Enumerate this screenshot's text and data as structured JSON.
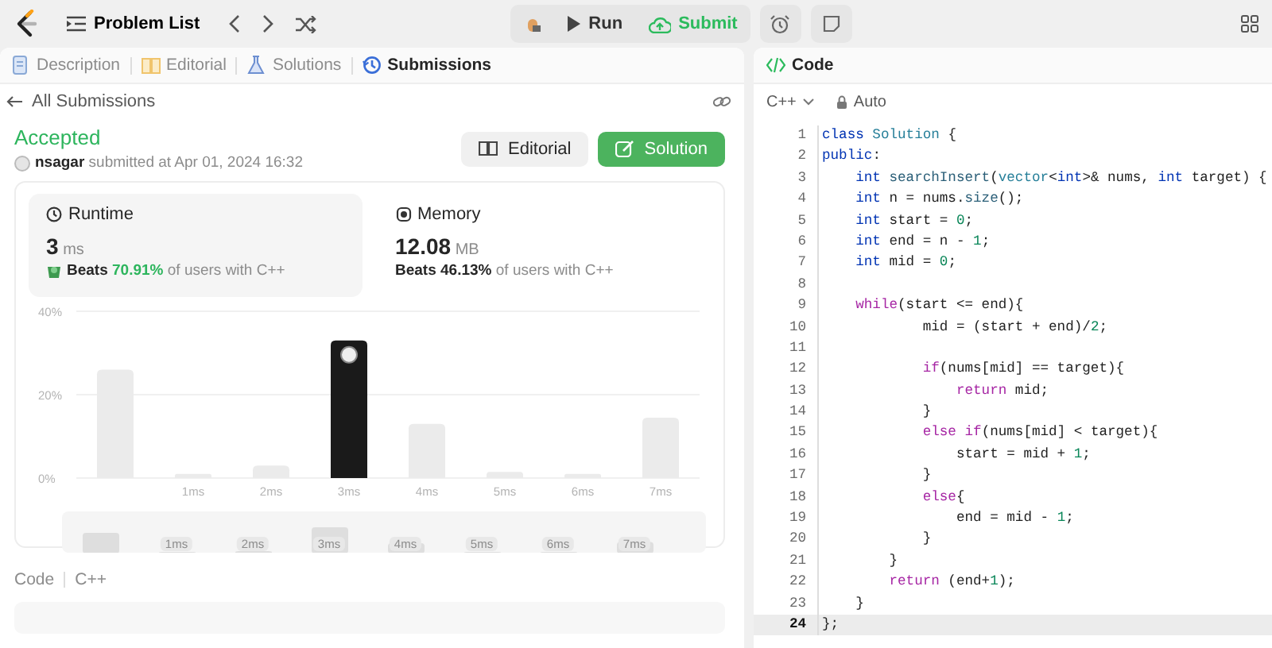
{
  "topbar": {
    "problem_list": "Problem List",
    "run": "Run",
    "submit": "Submit"
  },
  "left_tabs": [
    {
      "label": "Description",
      "kind": "description",
      "selected": false
    },
    {
      "label": "Editorial",
      "kind": "editorial",
      "selected": false
    },
    {
      "label": "Solutions",
      "kind": "solutions",
      "selected": false
    },
    {
      "label": "Submissions",
      "kind": "submissions",
      "selected": true
    }
  ],
  "back_link": "All Submissions",
  "submission": {
    "status": "Accepted",
    "user": "nsagar",
    "submitted": "submitted at Apr 01, 2024 16:32",
    "buttons": [
      {
        "label": "Editorial",
        "kind": "secondary"
      },
      {
        "label": "Solution",
        "kind": "primary"
      }
    ]
  },
  "stats": [
    {
      "kind": "runtime",
      "title": "Runtime",
      "value": "3",
      "unit": "ms",
      "beats_label": "Beats",
      "beats": "70.91%",
      "rest": "of users with C++",
      "selected": true
    },
    {
      "kind": "memory",
      "title": "Memory",
      "value": "12.08",
      "unit": "MB",
      "beats_label": "Beats",
      "beats": "46.13%",
      "rest": "of users with C++",
      "selected": false
    }
  ],
  "chart_data": {
    "type": "bar",
    "x": [
      0,
      1,
      2,
      3,
      4,
      5,
      6,
      7
    ],
    "xlim": [
      -0.5,
      7.5
    ],
    "xticks": [
      {
        "value": 1,
        "label": "1ms"
      },
      {
        "value": 2,
        "label": "2ms"
      },
      {
        "value": 3,
        "label": "3ms"
      },
      {
        "value": 4,
        "label": "4ms"
      },
      {
        "value": 5,
        "label": "5ms"
      },
      {
        "value": 6,
        "label": "6ms"
      },
      {
        "value": 7,
        "label": "7ms"
      }
    ],
    "yticks": [
      {
        "value": 0,
        "label": "0%"
      },
      {
        "value": 20,
        "label": "20%"
      },
      {
        "value": 40,
        "label": "40%"
      }
    ],
    "ylim": [
      0,
      40
    ],
    "series": [
      {
        "color": "#ebebeb",
        "values": [
          26,
          1,
          3,
          null,
          13,
          1.5,
          1,
          14.5
        ]
      },
      {
        "color": "#1a1a1a",
        "values": [
          null,
          null,
          null,
          33,
          null,
          null,
          null,
          null
        ]
      }
    ]
  },
  "navigator_labels": [
    "1ms",
    "2ms",
    "3ms",
    "4ms",
    "5ms",
    "6ms",
    "7ms"
  ],
  "code_footer": {
    "label": "Code",
    "language": "C++"
  },
  "editor": {
    "title": "Code",
    "language": "C++",
    "mode": "Auto",
    "lines": [
      {
        "n": "1",
        "active": false,
        "tokens": [
          {
            "kind": "kw",
            "text": "class"
          },
          {
            "kind": "ty",
            "text": " Solution"
          },
          {
            "kind": "p",
            "text": " {"
          }
        ]
      },
      {
        "n": "2",
        "active": false,
        "tokens": [
          {
            "kind": "kw",
            "text": "public"
          },
          {
            "kind": "p",
            "text": ":"
          }
        ]
      },
      {
        "n": "3",
        "active": false,
        "tokens": [
          {
            "kind": "kw",
            "text": "    int"
          },
          {
            "kind": "fn",
            "text": " searchInsert"
          },
          {
            "kind": "p",
            "text": "("
          },
          {
            "kind": "ty",
            "text": "vector"
          },
          {
            "kind": "p",
            "text": "<"
          },
          {
            "kind": "kw",
            "text": "int"
          },
          {
            "kind": "p",
            "text": ">& nums, "
          },
          {
            "kind": "kw",
            "text": "int"
          },
          {
            "kind": "p",
            "text": " target) {"
          }
        ]
      },
      {
        "n": "4",
        "active": false,
        "tokens": [
          {
            "kind": "kw",
            "text": "    int"
          },
          {
            "kind": "p",
            "text": " n = nums."
          },
          {
            "kind": "fn",
            "text": "size"
          },
          {
            "kind": "p",
            "text": "();"
          }
        ]
      },
      {
        "n": "5",
        "active": false,
        "tokens": [
          {
            "kind": "kw",
            "text": "    int"
          },
          {
            "kind": "p",
            "text": " start = "
          },
          {
            "kind": "num",
            "text": "0"
          },
          {
            "kind": "p",
            "text": ";"
          }
        ]
      },
      {
        "n": "6",
        "active": false,
        "tokens": [
          {
            "kind": "kw",
            "text": "    int"
          },
          {
            "kind": "p",
            "text": " end = n - "
          },
          {
            "kind": "num",
            "text": "1"
          },
          {
            "kind": "p",
            "text": ";"
          }
        ]
      },
      {
        "n": "7",
        "active": false,
        "tokens": [
          {
            "kind": "kw",
            "text": "    int"
          },
          {
            "kind": "p",
            "text": " mid = "
          },
          {
            "kind": "num",
            "text": "0"
          },
          {
            "kind": "p",
            "text": ";"
          }
        ]
      },
      {
        "n": "8",
        "active": false
      },
      {
        "n": "9",
        "active": false,
        "tokens": [
          {
            "kind": "ctl",
            "text": "    while"
          },
          {
            "kind": "p",
            "text": "(start <= end){"
          }
        ]
      },
      {
        "n": "10",
        "active": false,
        "tokens": [
          {
            "kind": "p",
            "text": "            mid = (start + end)/"
          },
          {
            "kind": "num",
            "text": "2"
          },
          {
            "kind": "p",
            "text": ";"
          }
        ]
      },
      {
        "n": "11",
        "active": false
      },
      {
        "n": "12",
        "active": false,
        "tokens": [
          {
            "kind": "ctl",
            "text": "            if"
          },
          {
            "kind": "p",
            "text": "(nums[mid] == target){"
          }
        ]
      },
      {
        "n": "13",
        "active": false,
        "tokens": [
          {
            "kind": "ctl",
            "text": "                return"
          },
          {
            "kind": "p",
            "text": " mid;"
          }
        ]
      },
      {
        "n": "14",
        "active": false,
        "tokens": [
          {
            "kind": "p",
            "text": "            }"
          }
        ]
      },
      {
        "n": "15",
        "active": false,
        "tokens": [
          {
            "kind": "ctl",
            "text": "            else if"
          },
          {
            "kind": "p",
            "text": "(nums[mid] < target){"
          }
        ]
      },
      {
        "n": "16",
        "active": false,
        "tokens": [
          {
            "kind": "p",
            "text": "                start = mid + "
          },
          {
            "kind": "num",
            "text": "1"
          },
          {
            "kind": "p",
            "text": ";"
          }
        ]
      },
      {
        "n": "17",
        "active": false,
        "tokens": [
          {
            "kind": "p",
            "text": "            }"
          }
        ]
      },
      {
        "n": "18",
        "active": false,
        "tokens": [
          {
            "kind": "ctl",
            "text": "            else"
          },
          {
            "kind": "p",
            "text": "{"
          }
        ]
      },
      {
        "n": "19",
        "active": false,
        "tokens": [
          {
            "kind": "p",
            "text": "                end = mid - "
          },
          {
            "kind": "num",
            "text": "1"
          },
          {
            "kind": "p",
            "text": ";"
          }
        ]
      },
      {
        "n": "20",
        "active": false,
        "tokens": [
          {
            "kind": "p",
            "text": "            }"
          }
        ]
      },
      {
        "n": "21",
        "active": false,
        "tokens": [
          {
            "kind": "p",
            "text": "        }"
          }
        ]
      },
      {
        "n": "22",
        "active": false,
        "tokens": [
          {
            "kind": "ctl",
            "text": "        return"
          },
          {
            "kind": "p",
            "text": " (end+"
          },
          {
            "kind": "num",
            "text": "1"
          },
          {
            "kind": "p",
            "text": ");"
          }
        ]
      },
      {
        "n": "23",
        "active": false,
        "tokens": [
          {
            "kind": "p",
            "text": "    }"
          }
        ]
      },
      {
        "n": "24",
        "active": true,
        "tokens": [
          {
            "kind": "p",
            "text": "};"
          }
        ]
      }
    ]
  }
}
